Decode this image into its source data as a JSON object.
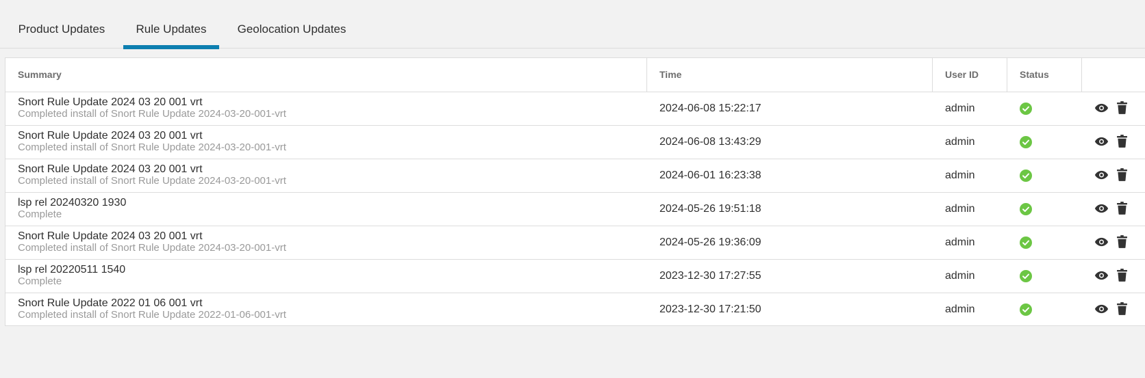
{
  "tabs": [
    {
      "label": "Product Updates",
      "active": false
    },
    {
      "label": "Rule Updates",
      "active": true
    },
    {
      "label": "Geolocation Updates",
      "active": false
    }
  ],
  "table": {
    "headers": {
      "summary": "Summary",
      "time": "Time",
      "user_id": "User ID",
      "status": "Status"
    },
    "rows": [
      {
        "title": "Snort Rule Update 2024 03 20 001 vrt",
        "subtitle": "Completed install of Snort Rule Update 2024-03-20-001-vrt",
        "time": "2024-06-08 15:22:17",
        "user": "admin",
        "status": "success"
      },
      {
        "title": "Snort Rule Update 2024 03 20 001 vrt",
        "subtitle": "Completed install of Snort Rule Update 2024-03-20-001-vrt",
        "time": "2024-06-08 13:43:29",
        "user": "admin",
        "status": "success"
      },
      {
        "title": "Snort Rule Update 2024 03 20 001 vrt",
        "subtitle": "Completed install of Snort Rule Update 2024-03-20-001-vrt",
        "time": "2024-06-01 16:23:38",
        "user": "admin",
        "status": "success"
      },
      {
        "title": "lsp rel 20240320 1930",
        "subtitle": "Complete",
        "time": "2024-05-26 19:51:18",
        "user": "admin",
        "status": "success"
      },
      {
        "title": "Snort Rule Update 2024 03 20 001 vrt",
        "subtitle": "Completed install of Snort Rule Update 2024-03-20-001-vrt",
        "time": "2024-05-26 19:36:09",
        "user": "admin",
        "status": "success"
      },
      {
        "title": "lsp rel 20220511 1540",
        "subtitle": "Complete",
        "time": "2023-12-30 17:27:55",
        "user": "admin",
        "status": "success"
      },
      {
        "title": "Snort Rule Update 2022 01 06 001 vrt",
        "subtitle": "Completed install of Snort Rule Update 2022-01-06-001-vrt",
        "time": "2023-12-30 17:21:50",
        "user": "admin",
        "status": "success"
      }
    ]
  },
  "icons": {
    "status": "check-circle-icon",
    "view": "eye-icon",
    "delete": "trash-icon"
  },
  "colors": {
    "accent": "#0d7fb0",
    "success": "#6cc644",
    "icon": "#333333"
  }
}
